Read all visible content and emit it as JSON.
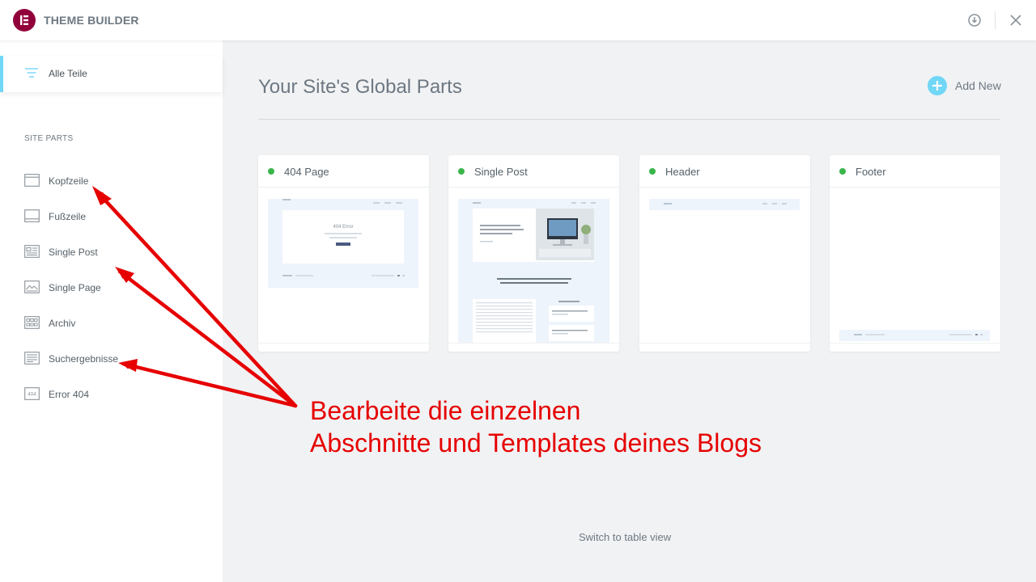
{
  "app": {
    "title": "THEME BUILDER"
  },
  "sidebar": {
    "all_parts_label": "Alle Teile",
    "section_title": "SITE PARTS",
    "items": [
      {
        "label": "Kopfzeile",
        "icon": "header-layout-icon"
      },
      {
        "label": "Fußzeile",
        "icon": "footer-layout-icon"
      },
      {
        "label": "Single Post",
        "icon": "single-post-icon"
      },
      {
        "label": "Single Page",
        "icon": "single-page-icon"
      },
      {
        "label": "Archiv",
        "icon": "archive-icon"
      },
      {
        "label": "Suchergebnisse",
        "icon": "search-results-icon"
      },
      {
        "label": "Error 404",
        "icon": "error-404-icon"
      }
    ],
    "error_icon_text": "404"
  },
  "main": {
    "title": "Your Site's Global Parts",
    "add_new_label": "Add New",
    "cards": [
      {
        "title": "404 Page",
        "status_color": "#39b54a"
      },
      {
        "title": "Single Post",
        "status_color": "#39b54a"
      },
      {
        "title": "Header",
        "status_color": "#39b54a"
      },
      {
        "title": "Footer",
        "status_color": "#39b54a"
      }
    ],
    "thumb_404_text": "404 Error",
    "switch_view_label": "Switch to table view"
  },
  "annotation": {
    "line1": "Bearbeite die einzelnen",
    "line2": "Abschnitte und Templates deines Blogs",
    "color": "#e60000"
  },
  "colors": {
    "brand": "#92003b",
    "accent": "#71d7f7",
    "add_button": "#71d7f7"
  }
}
